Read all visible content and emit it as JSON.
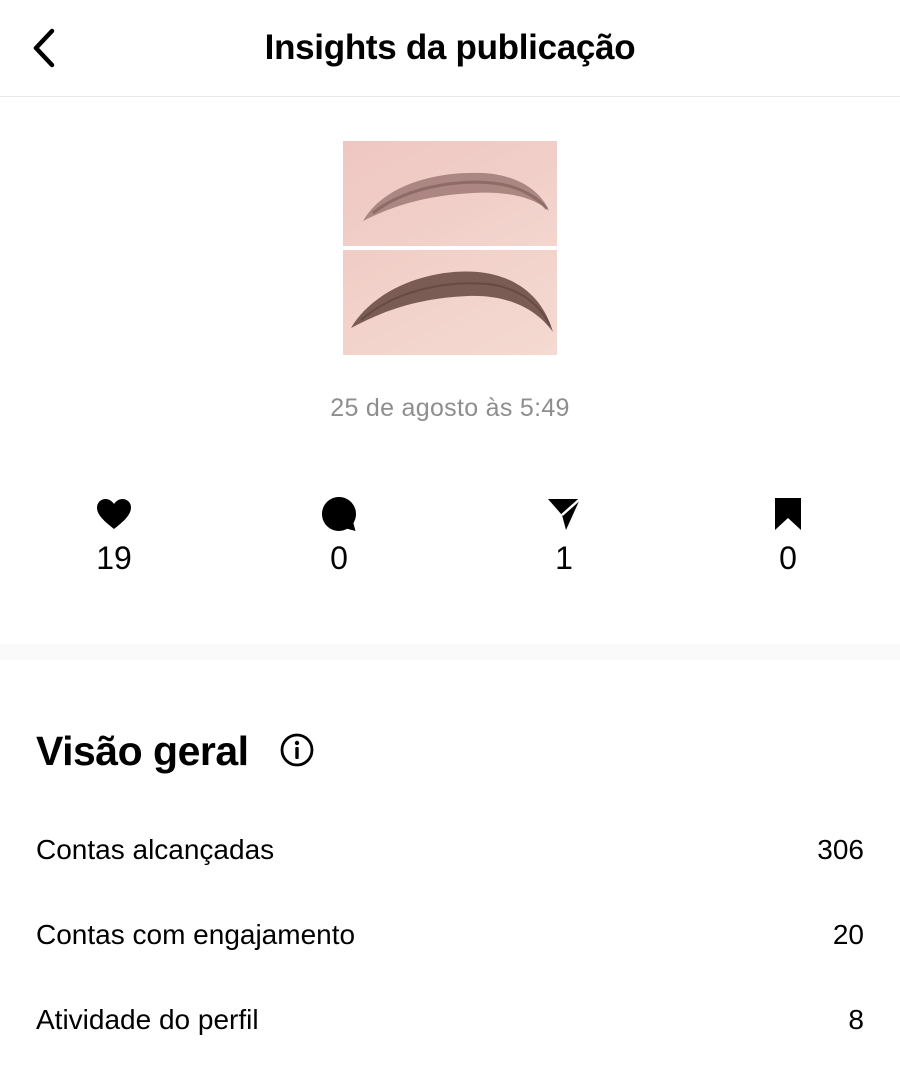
{
  "header": {
    "title": "Insights da publicação",
    "back_icon": "chevron-left-icon"
  },
  "post": {
    "date": "25 de agosto às 5:49"
  },
  "stats": [
    {
      "icon": "heart-icon",
      "value": "19"
    },
    {
      "icon": "comment-icon",
      "value": "0"
    },
    {
      "icon": "share-icon",
      "value": "1"
    },
    {
      "icon": "bookmark-icon",
      "value": "0"
    }
  ],
  "overview": {
    "title": "Visão geral",
    "info_icon": "info-icon",
    "rows": [
      {
        "label": "Contas alcançadas",
        "value": "306"
      },
      {
        "label": "Contas com engajamento",
        "value": "20"
      },
      {
        "label": "Atividade do perfil",
        "value": "8"
      }
    ]
  },
  "colors": {
    "text": "#000000",
    "muted": "#8e8e8e",
    "divider": "#e8e8e8",
    "band": "#fafafa"
  }
}
